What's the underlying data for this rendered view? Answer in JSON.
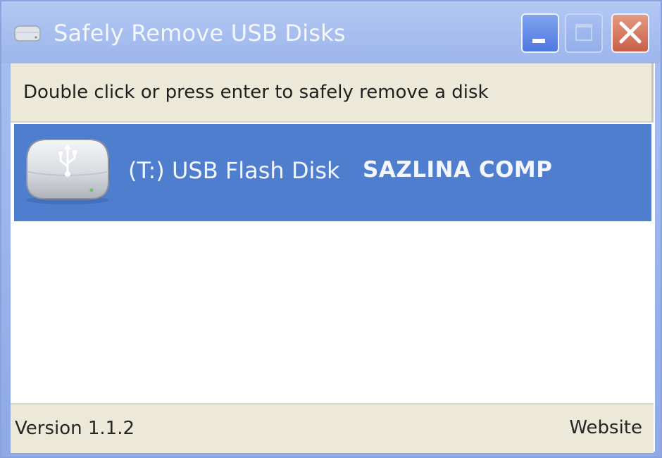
{
  "window": {
    "title": "Safely Remove USB Disks",
    "title_icon": "usb-drive-icon"
  },
  "controls": {
    "minimize_icon": "minimize-icon",
    "maximize_icon": "maximize-icon",
    "close_icon": "close-icon"
  },
  "header": {
    "instruction": "Double click or press enter to safely remove a disk"
  },
  "disks": [
    {
      "name": "(T:) USB Flash Disk",
      "vendor": "SAZLINA COMP",
      "icon": "usb-drive-icon",
      "selected": true
    }
  ],
  "status": {
    "version": "Version 1.1.2",
    "website_link": "Website"
  },
  "colors": {
    "titlebar": "#a9c0ef",
    "selection": "#4f7ecf",
    "panel": "#ece9d8",
    "close_button": "#d36e56"
  }
}
